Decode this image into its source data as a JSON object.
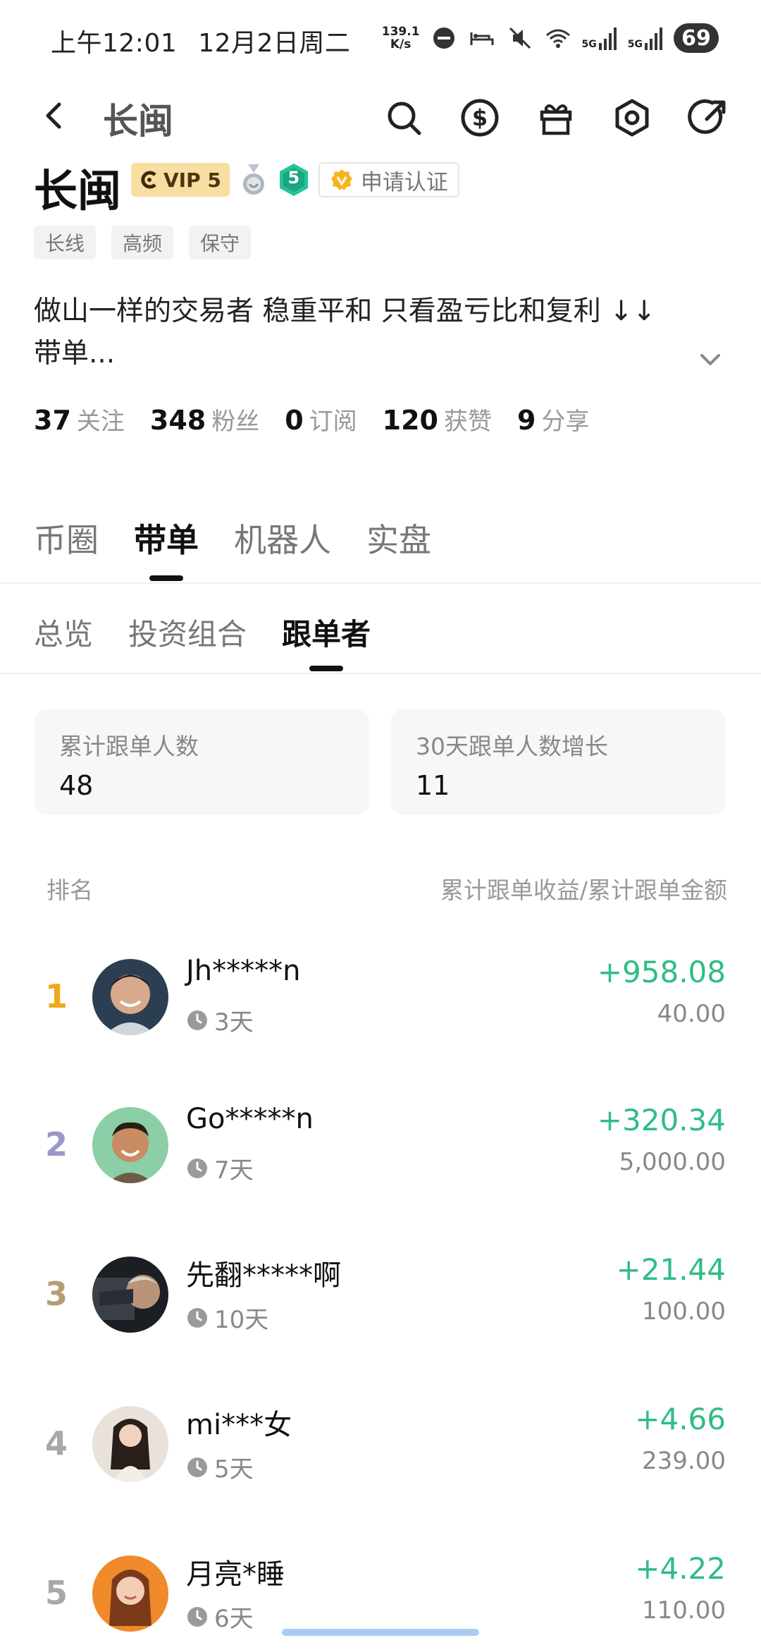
{
  "status_bar": {
    "time": "上午12:01",
    "date": "12月2日周二",
    "speed_value": "139.1",
    "speed_unit": "K/s",
    "signal_1": "5G",
    "signal_2": "5G",
    "battery": "69"
  },
  "nav": {
    "title": "长闽",
    "icons": [
      "search-icon",
      "dollar-icon",
      "gift-icon",
      "settings-icon",
      "share-icon"
    ]
  },
  "profile": {
    "name": "长闽",
    "vip_label": "VIP 5",
    "level": "5",
    "verify_label": "申请认证",
    "tags": [
      "长线",
      "高频",
      "保守"
    ],
    "bio_line1": "做山一样的交易者 稳重平和 只看盈亏比和复利 ↓↓",
    "bio_line2": "带单...",
    "stats": [
      {
        "num": "37",
        "label": "关注"
      },
      {
        "num": "348",
        "label": "粉丝"
      },
      {
        "num": "0",
        "label": "订阅"
      },
      {
        "num": "120",
        "label": "获赞"
      },
      {
        "num": "9",
        "label": "分享"
      }
    ]
  },
  "main_tabs": [
    "币圈",
    "带单",
    "机器人",
    "实盘"
  ],
  "main_tab_active": "带单",
  "sub_tabs": [
    "总览",
    "投资组合",
    "跟单者"
  ],
  "sub_tab_active": "跟单者",
  "summary": {
    "total_label": "累计跟单人数",
    "total_value": "48",
    "growth_label": "30天跟单人数增长",
    "growth_value": "11"
  },
  "list_header": {
    "left": "排名",
    "right": "累计跟单收益/累计跟单金额"
  },
  "colors": {
    "profit_green": "#2ebd85",
    "rank1": "#f0a818",
    "rank2": "#9a98c9",
    "rank3": "#b59d76",
    "rank_other": "#a8a8a8"
  },
  "followers": [
    {
      "rank": "1",
      "name": "Jh*****n",
      "days": "3天",
      "profit": "+958.08",
      "amount": "40.00"
    },
    {
      "rank": "2",
      "name": "Go*****n",
      "days": "7天",
      "profit": "+320.34",
      "amount": "5,000.00"
    },
    {
      "rank": "3",
      "name": "先翻*****啊",
      "days": "10天",
      "profit": "+21.44",
      "amount": "100.00"
    },
    {
      "rank": "4",
      "name": "mi***女",
      "days": "5天",
      "profit": "+4.66",
      "amount": "239.00"
    },
    {
      "rank": "5",
      "name": "月亮*睡",
      "days": "6天",
      "profit": "+4.22",
      "amount": "110.00"
    }
  ]
}
